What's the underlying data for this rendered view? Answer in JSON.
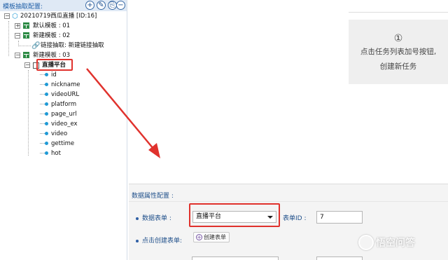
{
  "left_panel": {
    "title": "模板抽取配置:",
    "header_buttons": [
      "+",
      "✎",
      "⎘",
      "−"
    ],
    "root": {
      "label": "20210719西瓜直播 [ID:16]"
    },
    "templates": [
      {
        "label": "默认模板 : 01",
        "expander": "+"
      },
      {
        "label": "新建模板 : 02",
        "expander": "−",
        "children": [
          {
            "label": "链接抽取: 新建链接抽取"
          }
        ]
      },
      {
        "label": "新建模板 : 03",
        "expander": "−",
        "children": [
          {
            "label": "直播平台"
          }
        ]
      }
    ],
    "fields": [
      "id",
      "nickname",
      "videoURL",
      "platform",
      "page_url",
      "video_ex",
      "video",
      "gettime",
      "hot"
    ]
  },
  "tip": {
    "number": "①",
    "line1": "点击任务列表加号按钮,",
    "line2": "创建新任务"
  },
  "data_props": {
    "section_title": "数据属性配置 :",
    "table_label": "数据表单 :",
    "table_value": "直播平台",
    "table_id_label": "表单ID :",
    "table_id_value": "7",
    "create_label": "点击创建表单:",
    "create_button": "创建表单"
  },
  "watermark": {
    "text": "悟空问答"
  },
  "colors": {
    "highlight": "#e0322d",
    "accent_blue": "#1f4f8a",
    "field_dot": "#1f9ad6",
    "table_icon": "#2d8b45"
  }
}
